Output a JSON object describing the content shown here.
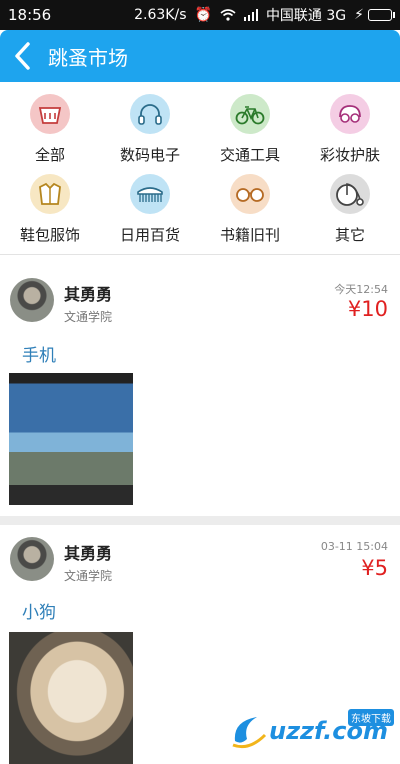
{
  "status_bar": {
    "time": "18:56",
    "speed": "2.63K/s",
    "carrier": "中国联通 3G"
  },
  "header": {
    "title": "跳蚤市场"
  },
  "categories": [
    {
      "label": "全部",
      "icon": "basket-icon",
      "color": "#f4c6c6",
      "stroke": "#c43c3c"
    },
    {
      "label": "数码电子",
      "icon": "headphones-icon",
      "color": "#bfe3f5",
      "stroke": "#2b6c8a"
    },
    {
      "label": "交通工具",
      "icon": "bicycle-icon",
      "color": "#cde9c9",
      "stroke": "#2b7a2b"
    },
    {
      "label": "彩妆护肤",
      "icon": "cosmetics-icon",
      "color": "#f4cde4",
      "stroke": "#a5307a"
    },
    {
      "label": "鞋包服饰",
      "icon": "jacket-icon",
      "color": "#f7e7c3",
      "stroke": "#b5861f"
    },
    {
      "label": "日用百货",
      "icon": "comb-icon",
      "color": "#bfe3f5",
      "stroke": "#2b6c8a"
    },
    {
      "label": "书籍旧刊",
      "icon": "glasses-icon",
      "color": "#f7ddc6",
      "stroke": "#b56a23"
    },
    {
      "label": "其它",
      "icon": "penny-farthing-icon",
      "color": "#dcdcdc",
      "stroke": "#444444"
    }
  ],
  "posts": [
    {
      "user": "其勇勇",
      "school": "文通学院",
      "time": "今天12:54",
      "price": "¥10",
      "title": "手机"
    },
    {
      "user": "其勇勇",
      "school": "文通学院",
      "time": "03-11 15:04",
      "price": "¥5",
      "title": "小狗"
    }
  ],
  "watermark": {
    "text": "uzzf.com",
    "sub": "东坡下载"
  }
}
